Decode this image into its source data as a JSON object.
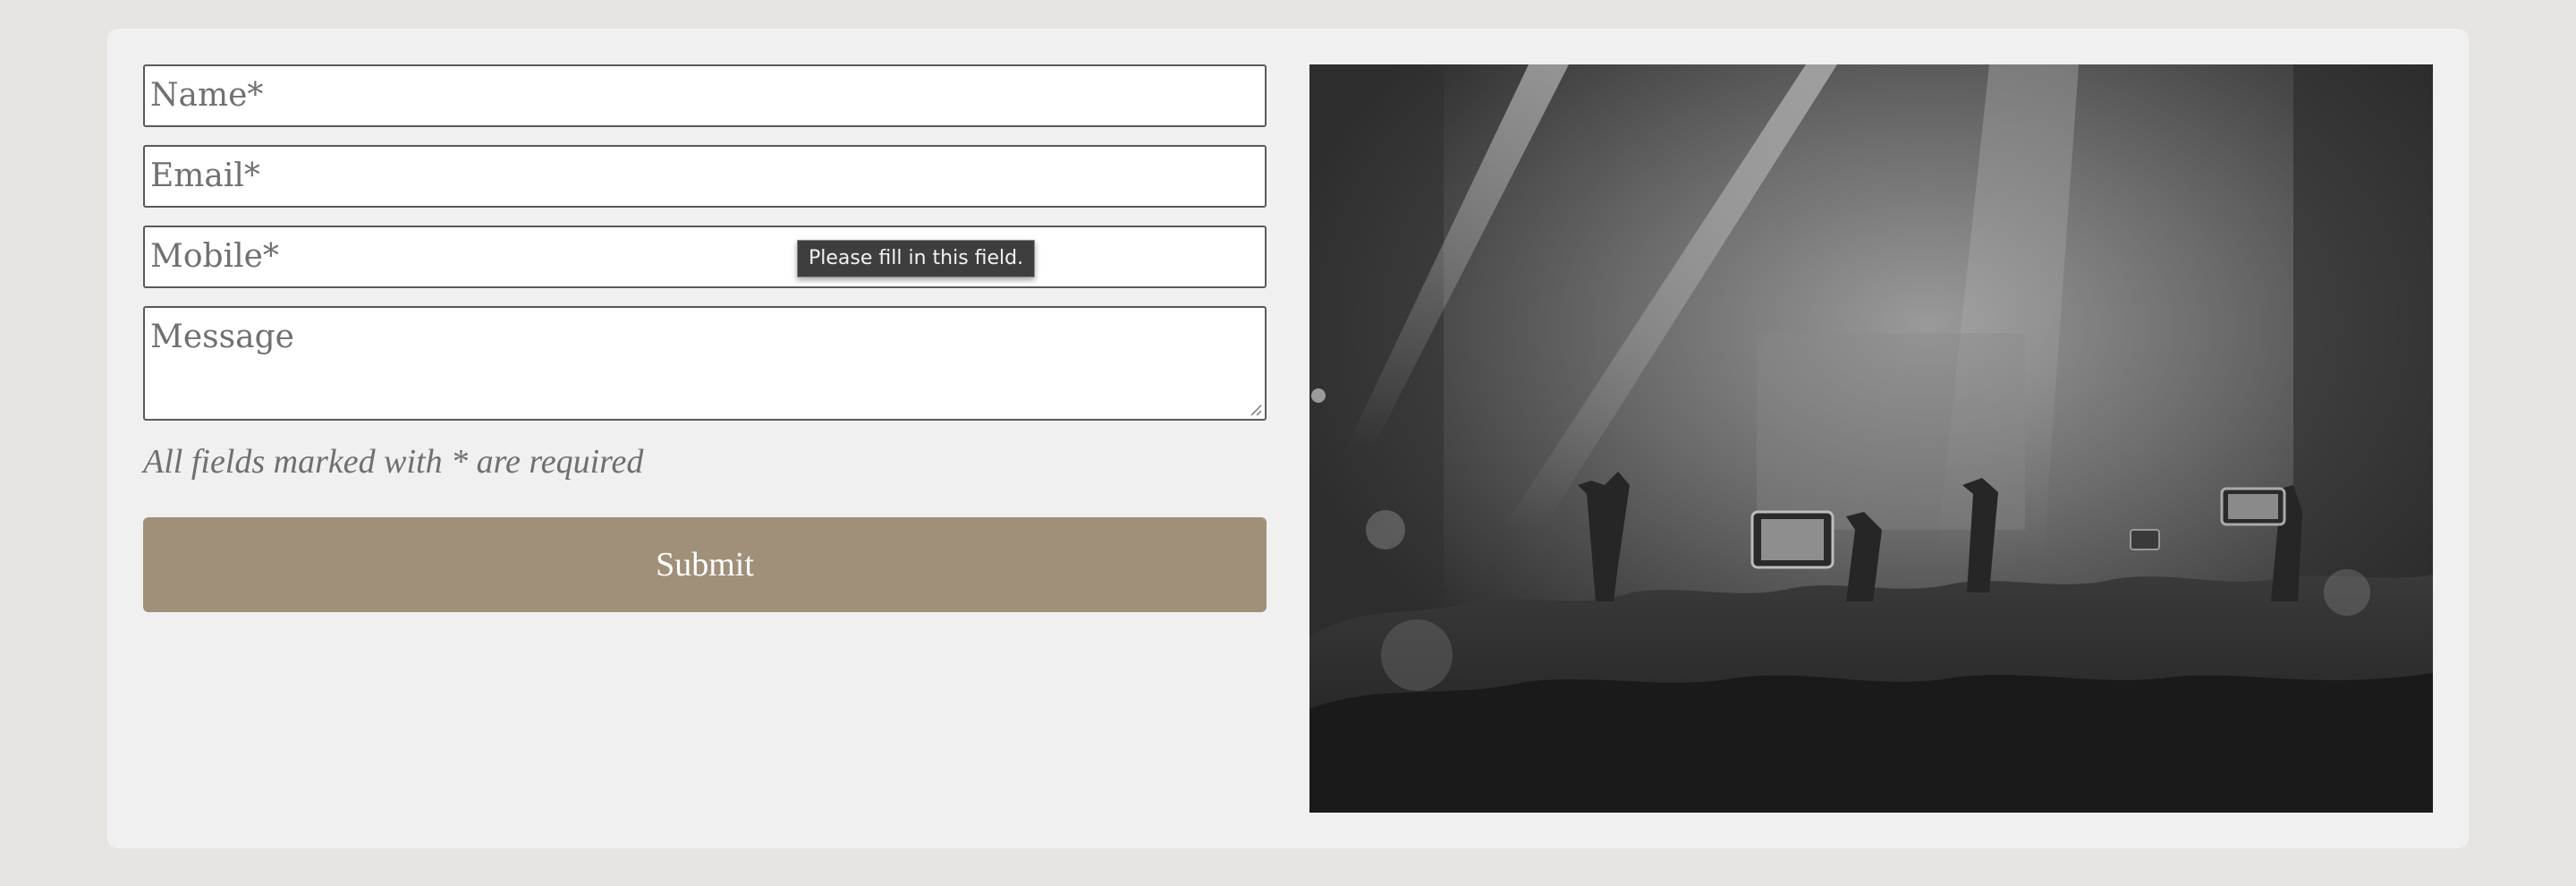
{
  "form": {
    "name_placeholder": "Name*",
    "email_placeholder": "Email*",
    "mobile_placeholder": "Mobile*",
    "message_placeholder": "Message",
    "required_note": "All fields marked with * are required",
    "submit_label": "Submit"
  },
  "tooltip": {
    "text": "Please fill in this field."
  },
  "colors": {
    "page_background": "#e6e5e2",
    "card_background": "#f0f0f0",
    "submit_button": "#a0907a"
  },
  "image": {
    "icon": "concert-crowd-photo"
  }
}
